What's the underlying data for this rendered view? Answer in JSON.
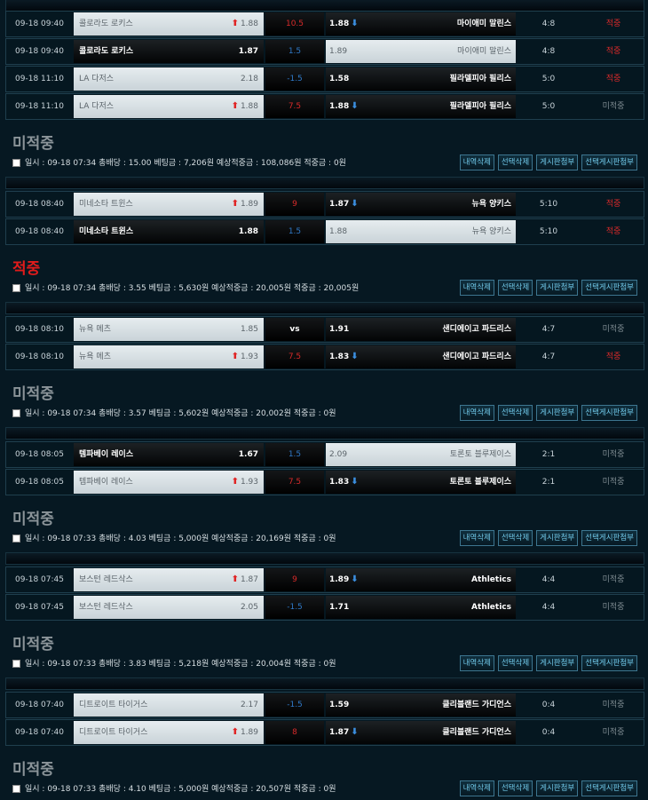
{
  "common": {
    "buttons": [
      "내역삭제",
      "선택삭제",
      "게시판첨부",
      "선택게시판첨부"
    ],
    "labels": {
      "date": "일시 :",
      "odds": "총배당 :",
      "bet": "베팅금 :",
      "expected": "예상적중금 :",
      "win": "적중금 :"
    }
  },
  "groups": [
    {
      "rows": [
        {
          "date": "09-18 09:40",
          "home": "콜로라도 로키스",
          "home_odds": "1.88",
          "home_sel": false,
          "home_arrow": "up",
          "mid": "10.5",
          "mid_color": "red",
          "away_odds": "1.88",
          "away": "마이애미 말린스",
          "away_sel": true,
          "away_arrow": "down",
          "score": "4:8",
          "result": "적중",
          "result_type": "hit"
        },
        {
          "date": "09-18 09:40",
          "home": "콜로라도 로키스",
          "home_odds": "1.87",
          "home_sel": true,
          "home_arrow": "",
          "mid": "1.5",
          "mid_color": "blue",
          "away_odds": "1.89",
          "away": "마이애미 말린스",
          "away_sel": false,
          "away_arrow": "",
          "score": "4:8",
          "result": "적중",
          "result_type": "hit"
        },
        {
          "date": "09-18 11:10",
          "home": "LA 다저스",
          "home_odds": "2.18",
          "home_sel": false,
          "home_arrow": "",
          "mid": "-1.5",
          "mid_color": "blue",
          "away_odds": "1.58",
          "away": "필라델피아 필리스",
          "away_sel": true,
          "away_arrow": "",
          "score": "5:0",
          "result": "적중",
          "result_type": "hit"
        },
        {
          "date": "09-18 11:10",
          "home": "LA 다저스",
          "home_odds": "1.88",
          "home_sel": false,
          "home_arrow": "up",
          "mid": "7.5",
          "mid_color": "red",
          "away_odds": "1.88",
          "away": "필라델피아 필리스",
          "away_sel": true,
          "away_arrow": "down",
          "score": "5:0",
          "result": "미적중",
          "result_type": "miss"
        }
      ],
      "status": "미적중",
      "status_type": "miss",
      "summary": {
        "date": "09-18 07:34",
        "odds": "15.00",
        "bet": "7,206원",
        "expected": "108,086원",
        "win": "0원"
      }
    },
    {
      "rows": [
        {
          "date": "09-18 08:40",
          "home": "미네소타 트윈스",
          "home_odds": "1.89",
          "home_sel": false,
          "home_arrow": "up",
          "mid": "9",
          "mid_color": "red",
          "away_odds": "1.87",
          "away": "뉴욕 양키스",
          "away_sel": true,
          "away_arrow": "down",
          "score": "5:10",
          "result": "적중",
          "result_type": "hit"
        },
        {
          "date": "09-18 08:40",
          "home": "미네소타 트윈스",
          "home_odds": "1.88",
          "home_sel": true,
          "home_arrow": "",
          "mid": "1.5",
          "mid_color": "blue",
          "away_odds": "1.88",
          "away": "뉴욕 양키스",
          "away_sel": false,
          "away_arrow": "",
          "score": "5:10",
          "result": "적중",
          "result_type": "hit"
        }
      ],
      "status": "적중",
      "status_type": "hit",
      "summary": {
        "date": "09-18 07:34",
        "odds": "3.55",
        "bet": "5,630원",
        "expected": "20,005원",
        "win": "20,005원"
      }
    },
    {
      "rows": [
        {
          "date": "09-18 08:10",
          "home": "뉴욕 메츠",
          "home_odds": "1.85",
          "home_sel": false,
          "home_arrow": "",
          "mid": "vs",
          "mid_color": "white",
          "away_odds": "1.91",
          "away": "샌디에이고 파드리스",
          "away_sel": true,
          "away_arrow": "",
          "score": "4:7",
          "result": "미적중",
          "result_type": "miss"
        },
        {
          "date": "09-18 08:10",
          "home": "뉴욕 메츠",
          "home_odds": "1.93",
          "home_sel": false,
          "home_arrow": "up",
          "mid": "7.5",
          "mid_color": "red",
          "away_odds": "1.83",
          "away": "샌디에이고 파드리스",
          "away_sel": true,
          "away_arrow": "down",
          "score": "4:7",
          "result": "적중",
          "result_type": "hit"
        }
      ],
      "status": "미적중",
      "status_type": "miss",
      "summary": {
        "date": "09-18 07:34",
        "odds": "3.57",
        "bet": "5,602원",
        "expected": "20,002원",
        "win": "0원"
      }
    },
    {
      "rows": [
        {
          "date": "09-18 08:05",
          "home": "템파베이 레이스",
          "home_odds": "1.67",
          "home_sel": true,
          "home_arrow": "",
          "mid": "1.5",
          "mid_color": "blue",
          "away_odds": "2.09",
          "away": "토론토 블루제이스",
          "away_sel": false,
          "away_arrow": "",
          "score": "2:1",
          "result": "미적중",
          "result_type": "miss"
        },
        {
          "date": "09-18 08:05",
          "home": "템파베이 레이스",
          "home_odds": "1.93",
          "home_sel": false,
          "home_arrow": "up",
          "mid": "7.5",
          "mid_color": "red",
          "away_odds": "1.83",
          "away": "토론토 블루제이스",
          "away_sel": true,
          "away_arrow": "down",
          "score": "2:1",
          "result": "미적중",
          "result_type": "miss"
        }
      ],
      "status": "미적중",
      "status_type": "miss",
      "summary": {
        "date": "09-18 07:33",
        "odds": "4.03",
        "bet": "5,000원",
        "expected": "20,169원",
        "win": "0원"
      }
    },
    {
      "rows": [
        {
          "date": "09-18 07:45",
          "home": "보스턴 레드삭스",
          "home_odds": "1.87",
          "home_sel": false,
          "home_arrow": "up",
          "mid": "9",
          "mid_color": "red",
          "away_odds": "1.89",
          "away": "Athletics",
          "away_sel": true,
          "away_arrow": "down",
          "score": "4:4",
          "result": "미적중",
          "result_type": "miss"
        },
        {
          "date": "09-18 07:45",
          "home": "보스턴 레드삭스",
          "home_odds": "2.05",
          "home_sel": false,
          "home_arrow": "",
          "mid": "-1.5",
          "mid_color": "blue",
          "away_odds": "1.71",
          "away": "Athletics",
          "away_sel": true,
          "away_arrow": "",
          "score": "4:4",
          "result": "미적중",
          "result_type": "miss"
        }
      ],
      "status": "미적중",
      "status_type": "miss",
      "summary": {
        "date": "09-18 07:33",
        "odds": "3.83",
        "bet": "5,218원",
        "expected": "20,004원",
        "win": "0원"
      }
    },
    {
      "rows": [
        {
          "date": "09-18 07:40",
          "home": "디트로이트 타이거스",
          "home_odds": "2.17",
          "home_sel": false,
          "home_arrow": "",
          "mid": "-1.5",
          "mid_color": "blue",
          "away_odds": "1.59",
          "away": "클리블랜드 가디언스",
          "away_sel": true,
          "away_arrow": "",
          "score": "0:4",
          "result": "미적중",
          "result_type": "miss"
        },
        {
          "date": "09-18 07:40",
          "home": "디트로이트 타이거스",
          "home_odds": "1.89",
          "home_sel": false,
          "home_arrow": "up",
          "mid": "8",
          "mid_color": "red",
          "away_odds": "1.87",
          "away": "클리블랜드 가디언스",
          "away_sel": true,
          "away_arrow": "down",
          "score": "0:4",
          "result": "미적중",
          "result_type": "miss"
        }
      ],
      "status": "미적중",
      "status_type": "miss",
      "summary": {
        "date": "09-18 07:33",
        "odds": "4.10",
        "bet": "5,000원",
        "expected": "20,507원",
        "win": "0원"
      }
    }
  ]
}
